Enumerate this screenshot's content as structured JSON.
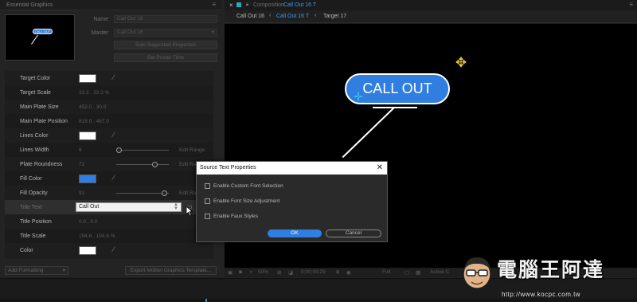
{
  "essential_graphics": {
    "tab_label": "Essential Graphics",
    "name_label": "Name",
    "name_value": "Call Out 16",
    "master_label": "Master",
    "master_value": "Call Out 16",
    "solo_button": "Solo Supported Properties",
    "poster_button": "Set Poster Time",
    "thumb_text": "CALL OUT",
    "rows": [
      {
        "label": "Target Color",
        "kind": "color",
        "color": "#ffffff"
      },
      {
        "label": "Target Scale",
        "kind": "value",
        "value": "33.3 , 33.3 %"
      },
      {
        "label": "Main Plate Size",
        "kind": "value",
        "value": "452.0 , 30.0"
      },
      {
        "label": "Main Plate Position",
        "kind": "value",
        "value": "818.0 , 487.0"
      },
      {
        "label": "Lines Color",
        "kind": "color",
        "color": "#ffffff"
      },
      {
        "label": "Lines Width",
        "kind": "slider",
        "value": "6",
        "slider_fraction": 0.05,
        "edit": "Edit Range"
      },
      {
        "label": "Plate Roundness",
        "kind": "slider",
        "value": "72",
        "slider_fraction": 0.72,
        "edit": "Edit Ra"
      },
      {
        "label": "Fill Color",
        "kind": "color",
        "color": "#2f7ee0"
      },
      {
        "label": "Fill Opacity",
        "kind": "slider",
        "value": "91",
        "slider_fraction": 0.91,
        "edit": "Edit Ra"
      },
      {
        "label": "Title Text",
        "kind": "text",
        "value": "Call Out"
      },
      {
        "label": "Title Position",
        "kind": "value",
        "value": "0.0 , 0.0"
      },
      {
        "label": "Title Scale",
        "kind": "value",
        "value": "194.6 , 194.6 %"
      },
      {
        "label": "Color",
        "kind": "color",
        "color": "#ffffff"
      }
    ],
    "add_formatting": "Add Formatting",
    "export_button": "Export Motion Graphics Template..."
  },
  "composition": {
    "close_glyph": "×",
    "title_label": "Composition",
    "title_name": "Call Out 16 T",
    "crumbs": [
      "Call Out 16",
      "Call Out 16 T",
      "Target 17"
    ],
    "callout_text": "CALL OUT",
    "footer": {
      "zoom": "50%",
      "timecode": "0;00;09;29",
      "resolution": "Full",
      "camera": "Active C"
    }
  },
  "dialog": {
    "title": "Source Text Properties",
    "close_glyph": "✕",
    "options": [
      {
        "label": "Enable Custom Font Selection",
        "checked": false
      },
      {
        "label": "Enable Font Size Adjustment",
        "checked": false
      },
      {
        "label": "Enable Faux Styles",
        "checked": false
      }
    ],
    "ok_label": "OK",
    "cancel_label": "Cancel"
  },
  "watermark": {
    "logo_text": "電腦王阿達",
    "url": "http://www.kocpc.com.tw"
  },
  "colors": {
    "accent_blue": "#2f7ee0",
    "link_blue": "#3b9bf1",
    "anchor_yellow": "#e8c23a",
    "anchor_cyan": "#34c8e6"
  }
}
